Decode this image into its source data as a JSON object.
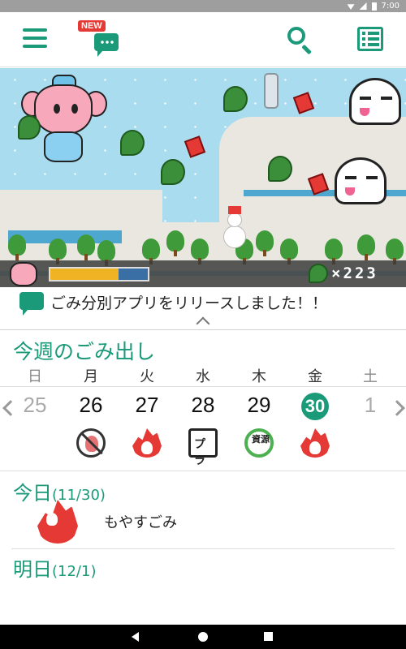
{
  "status_bar": {
    "time": "7:00"
  },
  "app_bar": {
    "menu_icon": "menu-icon",
    "news_badge": "NEW",
    "news_icon": "chat-bubble-icon",
    "search_icon": "search-icon",
    "list_icon": "list-icon",
    "accent_color": "#1a9a78"
  },
  "game": {
    "leaf_count": "×223",
    "progress_fraction": 0.7
  },
  "news": {
    "text": "ごみ分別アプリをリリースしました！！"
  },
  "week": {
    "title": "今週のごみ出し",
    "days": [
      {
        "dow": "日",
        "date": "25",
        "garbage_icon": ""
      },
      {
        "dow": "月",
        "date": "26",
        "garbage_icon": "no-burnable-icon"
      },
      {
        "dow": "火",
        "date": "27",
        "garbage_icon": "burnable-fire-icon"
      },
      {
        "dow": "水",
        "date": "28",
        "garbage_icon": "plastic-icon"
      },
      {
        "dow": "木",
        "date": "29",
        "garbage_icon": "resource-recycle-icon"
      },
      {
        "dow": "金",
        "date": "30",
        "garbage_icon": "burnable-fire-icon"
      },
      {
        "dow": "土",
        "date": "1",
        "garbage_icon": ""
      }
    ],
    "plastic_label": "プラ",
    "resource_label": "資源"
  },
  "today": {
    "label": "今日",
    "date": "(11/30)",
    "type": "もやすごみ"
  },
  "tomorrow": {
    "label": "明日",
    "date": "(12/1)"
  }
}
